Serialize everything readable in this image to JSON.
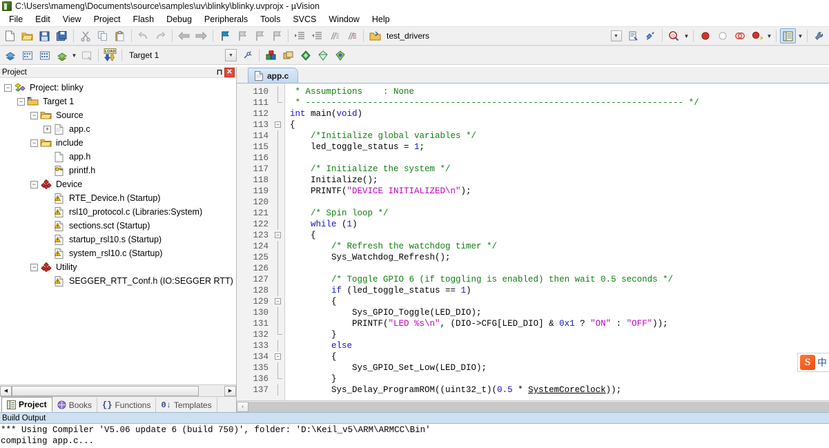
{
  "window": {
    "title": "C:\\Users\\mameng\\Documents\\source\\samples\\uv\\blinky\\blinky.uvprojx - µVision",
    "app_icon": "uvision-icon"
  },
  "menubar": {
    "items": [
      "File",
      "Edit",
      "View",
      "Project",
      "Flash",
      "Debug",
      "Peripherals",
      "Tools",
      "SVCS",
      "Window",
      "Help"
    ]
  },
  "toolbar_main": {
    "buttons": [
      {
        "name": "new-file-button",
        "icon": "new-file-icon"
      },
      {
        "name": "open-file-button",
        "icon": "open-folder-icon"
      },
      {
        "name": "save-button",
        "icon": "save-disk-icon"
      },
      {
        "name": "save-all-button",
        "icon": "save-all-icon"
      },
      {
        "name": "cut-button",
        "icon": "scissors-icon"
      },
      {
        "name": "copy-button",
        "icon": "copy-icon"
      },
      {
        "name": "paste-button",
        "icon": "paste-icon"
      },
      {
        "name": "undo-button",
        "icon": "undo-arrow-icon"
      },
      {
        "name": "redo-button",
        "icon": "redo-arrow-icon"
      },
      {
        "name": "navigate-back-button",
        "icon": "arrow-left-icon"
      },
      {
        "name": "navigate-forward-button",
        "icon": "arrow-right-icon"
      },
      {
        "name": "bookmark-toggle-button",
        "icon": "bookmark-flag-icon"
      },
      {
        "name": "bookmark-prev-button",
        "icon": "bookmark-prev-icon"
      },
      {
        "name": "bookmark-next-button",
        "icon": "bookmark-next-icon"
      },
      {
        "name": "bookmark-clear-button",
        "icon": "bookmark-clear-icon"
      },
      {
        "name": "indent-right-button",
        "icon": "indent-right-icon"
      },
      {
        "name": "indent-left-button",
        "icon": "indent-left-icon"
      },
      {
        "name": "comment-lines-button",
        "icon": "comment-lines-icon"
      },
      {
        "name": "uncomment-lines-button",
        "icon": "uncomment-lines-icon"
      }
    ],
    "project_icon": "project-window-icon",
    "project_label": "test_drivers",
    "combo_arrow": "chevron-down-icon",
    "find-in-files-icon": "find-in-files-icon",
    "configure-icon": "configure-target-icon",
    "search_icon": "search-dropdown-icon",
    "debug_buttons": [
      {
        "name": "insert-breakpoint-button",
        "icon": "breakpoint-red-icon"
      },
      {
        "name": "disable-breakpoint-button",
        "icon": "breakpoint-hollow-icon"
      },
      {
        "name": "disable-all-breakpoints-button",
        "icon": "breakpoints-disable-all-icon"
      },
      {
        "name": "kill-all-breakpoints-button",
        "icon": "breakpoints-kill-all-icon"
      }
    ],
    "window_layout_button": "window-layout-icon",
    "wrench_button": "configure-tools-icon"
  },
  "toolbar_build": {
    "buttons": [
      {
        "name": "translate-file-button",
        "icon": "translate-file-icon"
      },
      {
        "name": "build-target-button",
        "icon": "build-target-icon"
      },
      {
        "name": "rebuild-all-button",
        "icon": "rebuild-all-icon"
      },
      {
        "name": "batch-build-button",
        "icon": "batch-build-icon"
      },
      {
        "name": "stop-build-button",
        "icon": "stop-build-icon"
      },
      {
        "name": "download-button",
        "icon": "load-download-icon"
      }
    ],
    "target_label": "Target 1",
    "target_arrow": "chevron-down-icon",
    "target_options_icon": "target-options-icon",
    "right_buttons": [
      {
        "name": "manage-project-items-button",
        "icon": "manage-project-icon"
      },
      {
        "name": "manage-multi-project-button",
        "icon": "manage-multi-project-icon"
      },
      {
        "name": "pack-installer-button",
        "icon": "pack-installer-green-icon"
      },
      {
        "name": "manage-run-time-env-button",
        "icon": "run-time-env-icon"
      },
      {
        "name": "software-packs-button",
        "icon": "software-packs-icon"
      }
    ]
  },
  "project_panel": {
    "caption": "Project",
    "pin_icon": "pin-icon",
    "close_icon": "close-icon",
    "tree": [
      {
        "label": "Project: blinky",
        "depth": 0,
        "expander": "minus",
        "icon": "project-icon"
      },
      {
        "label": "Target 1",
        "depth": 1,
        "expander": "minus",
        "icon": "target-folder-icon"
      },
      {
        "label": "Source",
        "depth": 2,
        "expander": "minus",
        "icon": "group-folder-icon"
      },
      {
        "label": "app.c",
        "depth": 3,
        "expander": "plus",
        "icon": "c-file-icon"
      },
      {
        "label": "include",
        "depth": 2,
        "expander": "minus",
        "icon": "group-folder-icon"
      },
      {
        "label": "app.h",
        "depth": 3,
        "expander": "none",
        "icon": "header-file-icon"
      },
      {
        "label": "printf.h",
        "depth": 3,
        "expander": "none",
        "icon": "header-key-file-icon"
      },
      {
        "label": "Device",
        "depth": 2,
        "expander": "minus",
        "icon": "component-diamond-icon"
      },
      {
        "label": "RTE_Device.h (Startup)",
        "depth": 3,
        "expander": "none",
        "icon": "rte-file-warning-icon"
      },
      {
        "label": "rsl10_protocol.c (Libraries:System)",
        "depth": 3,
        "expander": "none",
        "icon": "rte-file-warning-icon"
      },
      {
        "label": "sections.sct (Startup)",
        "depth": 3,
        "expander": "none",
        "icon": "rte-file-warning-icon"
      },
      {
        "label": "startup_rsl10.s (Startup)",
        "depth": 3,
        "expander": "none",
        "icon": "rte-file-warning-icon"
      },
      {
        "label": "system_rsl10.c (Startup)",
        "depth": 3,
        "expander": "none",
        "icon": "rte-file-warning-icon"
      },
      {
        "label": "Utility",
        "depth": 2,
        "expander": "minus",
        "icon": "component-diamond-icon"
      },
      {
        "label": "SEGGER_RTT_Conf.h (IO:SEGGER RTT)",
        "depth": 3,
        "expander": "none",
        "icon": "rte-file-warning-icon"
      }
    ],
    "tabs": [
      {
        "label": "Project",
        "icon": "project-tab-icon",
        "selected": true
      },
      {
        "label": "Books",
        "icon": "books-tab-icon",
        "selected": false
      },
      {
        "label": "Functions",
        "icon": "functions-tab-icon",
        "selected": false
      },
      {
        "label": "Templates",
        "icon": "templates-tab-icon",
        "selected": false
      }
    ],
    "scroll_left_icon": "scroll-left-icon",
    "scroll_right_icon": "scroll-right-icon"
  },
  "editor": {
    "tabs": [
      {
        "label": "app.c",
        "icon": "c-file-icon",
        "selected": true
      }
    ],
    "first_line_number": 110,
    "lines": [
      {
        "n": 110,
        "fold": "bar",
        "tokens": [
          {
            "t": " * Assumptions    : None",
            "c": "cm"
          }
        ]
      },
      {
        "n": 111,
        "fold": "end",
        "tokens": [
          {
            "t": " * ------------------------------------------------------------------------- */",
            "c": "cm"
          }
        ]
      },
      {
        "n": 112,
        "fold": "",
        "tokens": [
          {
            "t": "int",
            "c": "kw"
          },
          {
            "t": " main(",
            "c": "pl"
          },
          {
            "t": "void",
            "c": "kw"
          },
          {
            "t": ")",
            "c": "pl"
          }
        ]
      },
      {
        "n": 113,
        "fold": "box",
        "tokens": [
          {
            "t": "{",
            "c": "pl"
          }
        ]
      },
      {
        "n": 114,
        "fold": "bar",
        "tokens": [
          {
            "t": "    /*Initialize global variables */",
            "c": "cm"
          }
        ]
      },
      {
        "n": 115,
        "fold": "bar",
        "tokens": [
          {
            "t": "    led_toggle_status = ",
            "c": "pl"
          },
          {
            "t": "1",
            "c": "nm"
          },
          {
            "t": ";",
            "c": "pl"
          }
        ]
      },
      {
        "n": 116,
        "fold": "bar",
        "tokens": [
          {
            "t": "",
            "c": "pl"
          }
        ]
      },
      {
        "n": 117,
        "fold": "bar",
        "tokens": [
          {
            "t": "    /* Initialize the system */",
            "c": "cm"
          }
        ]
      },
      {
        "n": 118,
        "fold": "bar",
        "tokens": [
          {
            "t": "    Initialize();",
            "c": "pl"
          }
        ]
      },
      {
        "n": 119,
        "fold": "bar",
        "tokens": [
          {
            "t": "    PRINTF(",
            "c": "pl"
          },
          {
            "t": "\"DEVICE INITIALIZED\\n\"",
            "c": "st"
          },
          {
            "t": ");",
            "c": "pl"
          }
        ]
      },
      {
        "n": 120,
        "fold": "bar",
        "tokens": [
          {
            "t": "",
            "c": "pl"
          }
        ]
      },
      {
        "n": 121,
        "fold": "bar",
        "tokens": [
          {
            "t": "    /* Spin loop */",
            "c": "cm"
          }
        ]
      },
      {
        "n": 122,
        "fold": "bar",
        "tokens": [
          {
            "t": "    ",
            "c": "pl"
          },
          {
            "t": "while",
            "c": "kw"
          },
          {
            "t": " (",
            "c": "pl"
          },
          {
            "t": "1",
            "c": "nm"
          },
          {
            "t": ")",
            "c": "pl"
          }
        ]
      },
      {
        "n": 123,
        "fold": "box",
        "tokens": [
          {
            "t": "    {",
            "c": "pl"
          }
        ]
      },
      {
        "n": 124,
        "fold": "bar",
        "tokens": [
          {
            "t": "        /* Refresh the watchdog timer */",
            "c": "cm"
          }
        ]
      },
      {
        "n": 125,
        "fold": "bar",
        "tokens": [
          {
            "t": "        Sys_Watchdog_Refresh();",
            "c": "pl"
          }
        ]
      },
      {
        "n": 126,
        "fold": "bar",
        "tokens": [
          {
            "t": "",
            "c": "pl"
          }
        ]
      },
      {
        "n": 127,
        "fold": "bar",
        "tokens": [
          {
            "t": "        /* Toggle GPIO 6 (if toggling is enabled) then wait 0.5 seconds */",
            "c": "cm"
          }
        ]
      },
      {
        "n": 128,
        "fold": "bar",
        "tokens": [
          {
            "t": "        ",
            "c": "pl"
          },
          {
            "t": "if",
            "c": "kw"
          },
          {
            "t": " (led_toggle_status == ",
            "c": "pl"
          },
          {
            "t": "1",
            "c": "nm"
          },
          {
            "t": ")",
            "c": "pl"
          }
        ]
      },
      {
        "n": 129,
        "fold": "box",
        "tokens": [
          {
            "t": "        {",
            "c": "pl"
          }
        ]
      },
      {
        "n": 130,
        "fold": "bar",
        "tokens": [
          {
            "t": "            Sys_GPIO_Toggle(LED_DIO);",
            "c": "pl"
          }
        ]
      },
      {
        "n": 131,
        "fold": "bar",
        "tokens": [
          {
            "t": "            PRINTF(",
            "c": "pl"
          },
          {
            "t": "\"LED %s\\n\"",
            "c": "st"
          },
          {
            "t": ", (DIO->CFG[LED_DIO] & ",
            "c": "pl"
          },
          {
            "t": "0x1",
            "c": "nm"
          },
          {
            "t": " ? ",
            "c": "pl"
          },
          {
            "t": "\"ON\"",
            "c": "st"
          },
          {
            "t": " : ",
            "c": "pl"
          },
          {
            "t": "\"OFF\"",
            "c": "st"
          },
          {
            "t": "));",
            "c": "pl"
          }
        ]
      },
      {
        "n": 132,
        "fold": "end",
        "tokens": [
          {
            "t": "        }",
            "c": "pl"
          }
        ]
      },
      {
        "n": 133,
        "fold": "bar",
        "tokens": [
          {
            "t": "        ",
            "c": "pl"
          },
          {
            "t": "else",
            "c": "kw"
          }
        ]
      },
      {
        "n": 134,
        "fold": "box",
        "tokens": [
          {
            "t": "        {",
            "c": "pl"
          }
        ]
      },
      {
        "n": 135,
        "fold": "bar",
        "tokens": [
          {
            "t": "            Sys_GPIO_Set_Low(LED_DIO);",
            "c": "pl"
          }
        ]
      },
      {
        "n": 136,
        "fold": "end",
        "tokens": [
          {
            "t": "        }",
            "c": "pl"
          }
        ]
      },
      {
        "n": 137,
        "fold": "bar",
        "tokens": [
          {
            "t": "        Sys_Delay_ProgramROM((uint32_t)(",
            "c": "pl"
          },
          {
            "t": "0.5",
            "c": "nm"
          },
          {
            "t": " * ",
            "c": "pl"
          },
          {
            "t": "SystemCoreClock",
            "c": "ul"
          },
          {
            "t": "));",
            "c": "pl"
          }
        ]
      }
    ],
    "scroll_left_icon": "scroll-left-icon"
  },
  "build_output": {
    "caption": "Build Output",
    "lines": [
      "*** Using Compiler 'V5.06 update 6 (build 750)', folder: 'D:\\Keil_v5\\ARM\\ARMCC\\Bin'",
      "compiling app.c..."
    ]
  },
  "ime": {
    "logo": "S",
    "mode": "中",
    "name": "sogou-ime-toolbar"
  },
  "colors": {
    "comment": "#108010",
    "keyword": "#1414c8",
    "string": "#c000c0",
    "number": "#1414c8",
    "tab_active": "#c3d8ef",
    "build_caption": "#cfe0f0",
    "close_button": "#e04a3a"
  }
}
